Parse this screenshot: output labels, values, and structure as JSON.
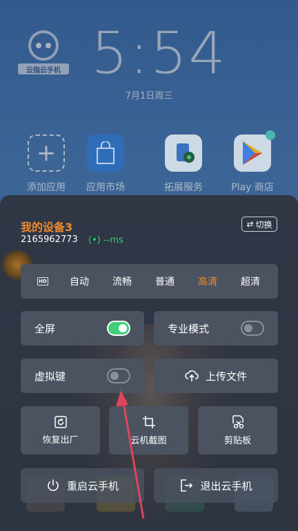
{
  "background": {
    "logo_text": "云指云手机",
    "clock": "5:54",
    "date": "7月1日周三",
    "apps": [
      {
        "label": "添加应用",
        "icon": "add-app-icon"
      },
      {
        "label": "应用市场",
        "icon": "app-market-icon"
      },
      {
        "label": "拓展服务",
        "icon": "extension-service-icon"
      },
      {
        "label": "Play 商店",
        "icon": "play-store-icon"
      }
    ]
  },
  "panel": {
    "device_name": "我的设备3",
    "device_id": "2165962773",
    "latency": "--ms",
    "switch_label": "切换",
    "quality": {
      "options": [
        "自动",
        "流畅",
        "普通",
        "高清",
        "超清"
      ],
      "selected": "高清"
    },
    "toggles": [
      {
        "label": "全屏",
        "on": true
      },
      {
        "label": "专业模式",
        "on": false
      },
      {
        "label": "虚拟键",
        "on": false
      }
    ],
    "upload_label": "上传文件",
    "tools": [
      {
        "label": "恢复出厂",
        "icon": "factory-reset-icon"
      },
      {
        "label": "云机截图",
        "icon": "crop-screenshot-icon"
      },
      {
        "label": "剪贴板",
        "icon": "clipboard-icon"
      }
    ],
    "restart_label": "重启云手机",
    "exit_label": "退出云手机"
  },
  "colors": {
    "accent": "#f08a2a",
    "toggle_on": "#3fcf7a",
    "latency": "#2ed46f",
    "annotation_arrow": "#e0455a"
  }
}
